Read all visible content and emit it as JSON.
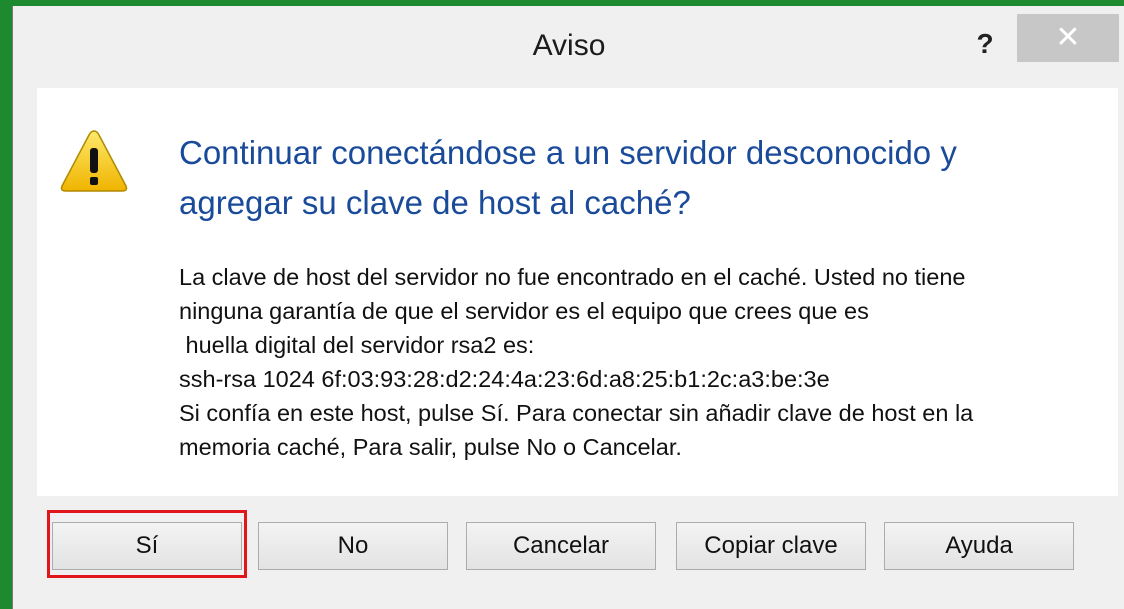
{
  "window": {
    "title": "Aviso",
    "help_label": "?",
    "close_label": "✕"
  },
  "message": {
    "icon": "warning-icon",
    "instruction_lines": [
      "Continuar conectándose a un servidor desconocido y",
      "agregar su clave de host al caché?"
    ],
    "detail_lines": [
      "La clave de host del servidor no fue encontrado en el caché. Usted no tiene",
      "ninguna garantía de que el servidor es el equipo que crees que es",
      " huella digital del servidor rsa2 es:",
      "ssh-rsa 1024 6f:03:93:28:d2:24:4a:23:6d:a8:25:b1:2c:a3:be:3e",
      "Si confía en este host, pulse Sí. Para conectar sin añadir clave de host en la",
      "memoria caché, Para salir, pulse No o Cancelar."
    ]
  },
  "buttons": {
    "yes": "Sí",
    "no": "No",
    "cancel": "Cancelar",
    "copy_key": "Copiar clave",
    "help": "Ayuda"
  },
  "colors": {
    "instruction_text": "#1a4a9a",
    "highlight_border": "#e0161c",
    "desktop_green": "#1d8a2f"
  }
}
